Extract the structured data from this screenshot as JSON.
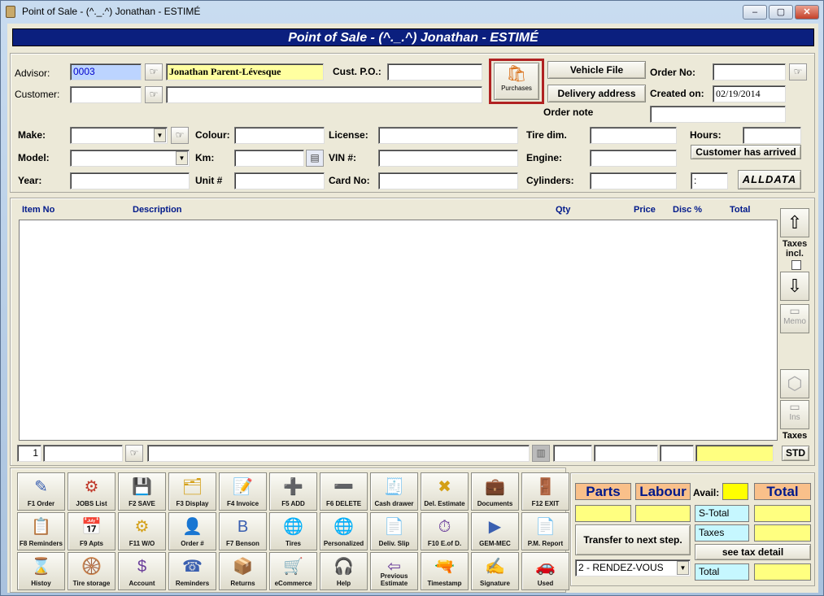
{
  "window": {
    "title": "Point of Sale - (^._.^) Jonathan - ESTIMÉ",
    "min": "–",
    "max": "▢",
    "close": "✕"
  },
  "banner": "Point of Sale - (^._.^) Jonathan - ESTIMÉ",
  "header": {
    "advisor_label": "Advisor:",
    "advisor_code": "0003",
    "advisor_name": "Jonathan Parent-Lévesque",
    "cust_po_label": "Cust. P.O.:",
    "cust_po": "",
    "customer_label": "Customer:",
    "customer_code": "",
    "customer_name": "",
    "purchases_label": "Purchases",
    "vehicle_file": "Vehicle File",
    "delivery_address": "Delivery address",
    "order_no_label": "Order No:",
    "order_no": "",
    "created_on_label": "Created on:",
    "created_on": "02/19/2014",
    "order_note_label": "Order note",
    "order_note": ""
  },
  "vehicle": {
    "make_label": "Make:",
    "model_label": "Model:",
    "year_label": "Year:",
    "colour_label": "Colour:",
    "km_label": "Km:",
    "unit_label": "Unit #",
    "license_label": "License:",
    "vin_label": "VIN #:",
    "card_label": "Card No:",
    "tire_label": "Tire dim.",
    "engine_label": "Engine:",
    "cyl_label": "Cylinders:",
    "hours_label": "Hours:",
    "customer_arrived": "Customer has arrived",
    "time_value": ":",
    "alldata": "ALLDATA"
  },
  "grid": {
    "columns": [
      "Item No",
      "Description",
      "Qty",
      "Price",
      "Disc %",
      "Total"
    ],
    "row_number": "1"
  },
  "side": {
    "taxes_incl": "Taxes incl.",
    "memo": "Memo",
    "ins": "Ins",
    "taxes": "Taxes",
    "std": "STD"
  },
  "fkeys": [
    [
      "F1 Order",
      "JOBS List",
      "F2 SAVE",
      "F3 Display",
      "F4 Invoice",
      "F5 ADD",
      "F6 DELETE",
      "Cash drawer",
      "Del. Estimate",
      "Documents",
      "F12 EXIT"
    ],
    [
      "F8 Reminders",
      "F9 Apts",
      "F11 W/O",
      "Order #",
      "F7 Benson",
      "Tires",
      "Personalized",
      "Deliv. Slip",
      "F10 E.of D.",
      "GEM-MEC",
      "P.M. Report"
    ],
    [
      "Histoy",
      "Tire storage",
      "Account",
      "Reminders",
      "Returns",
      "eCommerce",
      "Help",
      "Previous Estimate",
      "Timestamp",
      "Signature",
      "Used"
    ]
  ],
  "icons": [
    [
      "order-icon",
      "jobs-list-icon",
      "save-icon",
      "display-icon",
      "invoice-icon",
      "add-icon",
      "delete-icon",
      "cash-drawer-icon",
      "delete-estimate-icon",
      "documents-icon",
      "exit-icon"
    ],
    [
      "reminders-icon",
      "appointments-icon",
      "work-order-icon",
      "order-number-icon",
      "benson-icon",
      "tires-icon",
      "personalized-icon",
      "delivery-slip-icon",
      "end-of-day-icon",
      "youtube-icon",
      "pm-report-icon"
    ],
    [
      "history-icon",
      "tire-storage-icon",
      "account-icon",
      "reminders-phone-icon",
      "returns-icon",
      "ecommerce-icon",
      "help-icon",
      "previous-estimate-icon",
      "timestamp-icon",
      "signature-icon",
      "used-icon"
    ]
  ],
  "glyphs": [
    [
      "✎",
      "⚙",
      "💾",
      "🗂",
      "📝",
      "➕",
      "➖",
      "🧾",
      "✖",
      "💼",
      "🚪"
    ],
    [
      "📋",
      "📅",
      "⚙",
      "👤",
      "B",
      "🌐",
      "🌐",
      "📄",
      "⏱",
      "▶",
      "📄"
    ],
    [
      "⌛",
      "🛞",
      "$",
      "☎",
      "📦",
      "🛒",
      "🎧",
      "⇦",
      "🔫",
      "✍",
      "🚗"
    ]
  ],
  "totals": {
    "parts": "Parts",
    "labour": "Labour",
    "avail": "Avail:",
    "total": "Total",
    "stotal": "S-Total",
    "taxes": "Taxes",
    "see_tax_detail": "see tax detail",
    "total_lbl": "Total",
    "transfer": "Transfer to next step.",
    "status": "2 - RENDEZ-VOUS"
  },
  "colors": {
    "banner": "#0b1f7e",
    "yellow_field": "#ffffa0",
    "total_header": "#f9c08a",
    "cyan_label": "#c6f7ff"
  }
}
